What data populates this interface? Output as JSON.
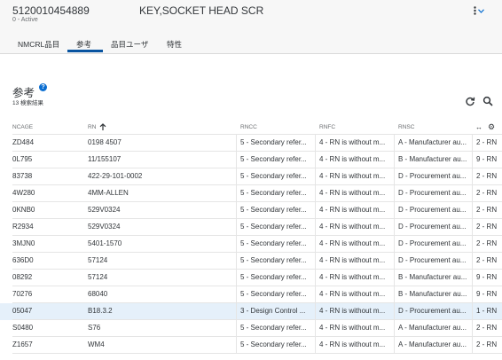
{
  "header": {
    "object_id": "5120010454889",
    "status": "0 - Active",
    "title": "KEY,SOCKET HEAD SCR",
    "more_icon": "more-vertical-icon",
    "chevron_icon": "chevron-down-icon"
  },
  "tabs": [
    {
      "label": "NMCRL品目"
    },
    {
      "label": "参考",
      "active": true
    },
    {
      "label": "品目ユーザ"
    },
    {
      "label": "特性"
    }
  ],
  "section": {
    "title": "参考",
    "help_icon": "?",
    "count": "13 検索結果",
    "refresh_icon": "refresh-icon",
    "search_icon": "search-icon"
  },
  "table": {
    "columns": [
      "NCAGE",
      "RN",
      "RNCC",
      "RNFC",
      "RNSC"
    ],
    "sort_icon": "↑",
    "resize_icon": "↔",
    "settings_icon": "⚙",
    "rows": [
      {
        "ncage": "ZD484",
        "rn": "0198 4507",
        "rncc": "5 - Secondary refer...",
        "rnfc": "4 - RN is without m...",
        "rnsc": "A - Manufacturer au...",
        "extra": "2 - RN"
      },
      {
        "ncage": "0L795",
        "rn": "11/155107",
        "rncc": "5 - Secondary refer...",
        "rnfc": "4 - RN is without m...",
        "rnsc": "B - Manufacturer au...",
        "extra": "9 - RN"
      },
      {
        "ncage": "83738",
        "rn": "422-29-101-0002",
        "rncc": "5 - Secondary refer...",
        "rnfc": "4 - RN is without m...",
        "rnsc": "D - Procurement au...",
        "extra": "2 - RN"
      },
      {
        "ncage": "4W280",
        "rn": "4MM-ALLEN",
        "rncc": "5 - Secondary refer...",
        "rnfc": "4 - RN is without m...",
        "rnsc": "D - Procurement au...",
        "extra": "2 - RN"
      },
      {
        "ncage": "0KNB0",
        "rn": "529V0324",
        "rncc": "5 - Secondary refer...",
        "rnfc": "4 - RN is without m...",
        "rnsc": "D - Procurement au...",
        "extra": "2 - RN"
      },
      {
        "ncage": "R2934",
        "rn": "529V0324",
        "rncc": "5 - Secondary refer...",
        "rnfc": "4 - RN is without m...",
        "rnsc": "D - Procurement au...",
        "extra": "2 - RN"
      },
      {
        "ncage": "3MJN0",
        "rn": "5401-1570",
        "rncc": "5 - Secondary refer...",
        "rnfc": "4 - RN is without m...",
        "rnsc": "D - Procurement au...",
        "extra": "2 - RN"
      },
      {
        "ncage": "636D0",
        "rn": "57124",
        "rncc": "5 - Secondary refer...",
        "rnfc": "4 - RN is without m...",
        "rnsc": "D - Procurement au...",
        "extra": "2 - RN"
      },
      {
        "ncage": "08292",
        "rn": "57124",
        "rncc": "5 - Secondary refer...",
        "rnfc": "4 - RN is without m...",
        "rnsc": "B - Manufacturer au...",
        "extra": "9 - RN"
      },
      {
        "ncage": "70276",
        "rn": "68040",
        "rncc": "5 - Secondary refer...",
        "rnfc": "4 - RN is without m...",
        "rnsc": "B - Manufacturer au...",
        "extra": "9 - RN"
      },
      {
        "ncage": "05047",
        "rn": "B18.3.2",
        "rncc": "3 - Design Control ...",
        "rnfc": "4 - RN is without m...",
        "rnsc": "D - Procurement au...",
        "extra": "1 - RN",
        "selected": true
      },
      {
        "ncage": "S0480",
        "rn": "S76",
        "rncc": "5 - Secondary refer...",
        "rnfc": "4 - RN is without m...",
        "rnsc": "A - Manufacturer au...",
        "extra": "2 - RN"
      },
      {
        "ncage": "Z1657",
        "rn": "WM4",
        "rncc": "5 - Secondary refer...",
        "rnfc": "4 - RN is without m...",
        "rnsc": "A - Manufacturer au...",
        "extra": "2 - RN"
      }
    ]
  }
}
